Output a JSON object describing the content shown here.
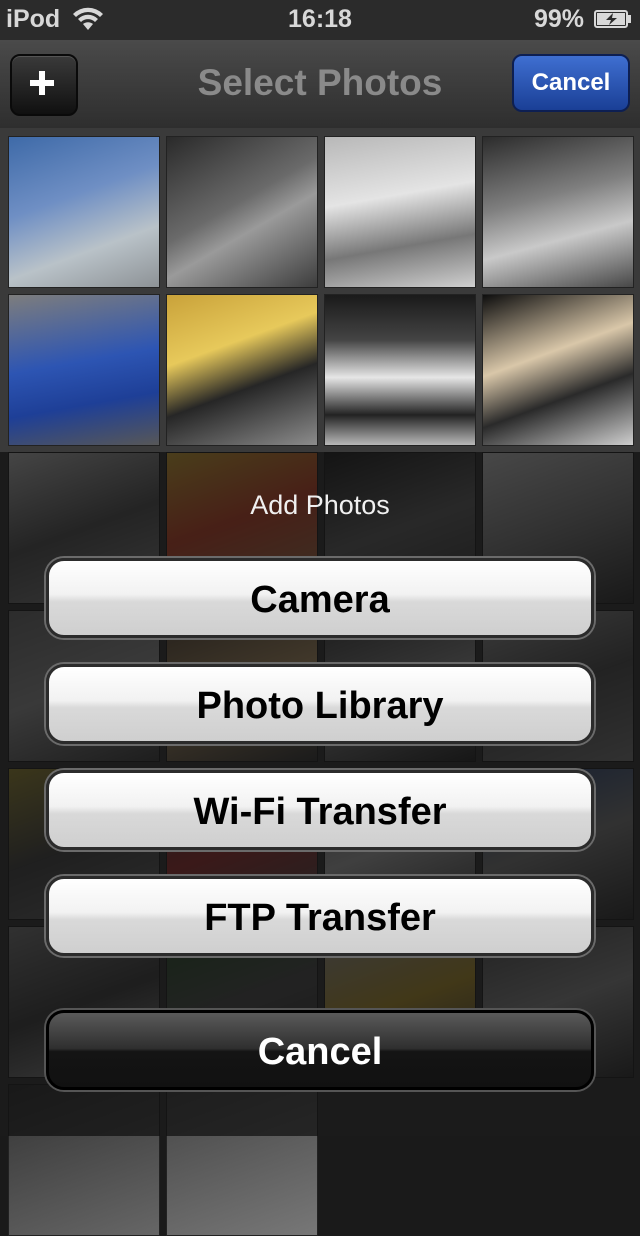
{
  "status_bar": {
    "carrier": "iPod",
    "time": "16:18",
    "battery": "99%"
  },
  "nav": {
    "title": "Select Photos",
    "cancel_label": "Cancel"
  },
  "action_sheet": {
    "title": "Add Photos",
    "buttons": [
      "Camera",
      "Photo Library",
      "Wi-Fi Transfer",
      "FTP Transfer"
    ],
    "cancel_label": "Cancel"
  },
  "colors": {
    "nav_cancel_accent": "#2a56b8",
    "sheet_button_light": "#ececec",
    "sheet_cancel_dark": "#1e1e1e"
  }
}
